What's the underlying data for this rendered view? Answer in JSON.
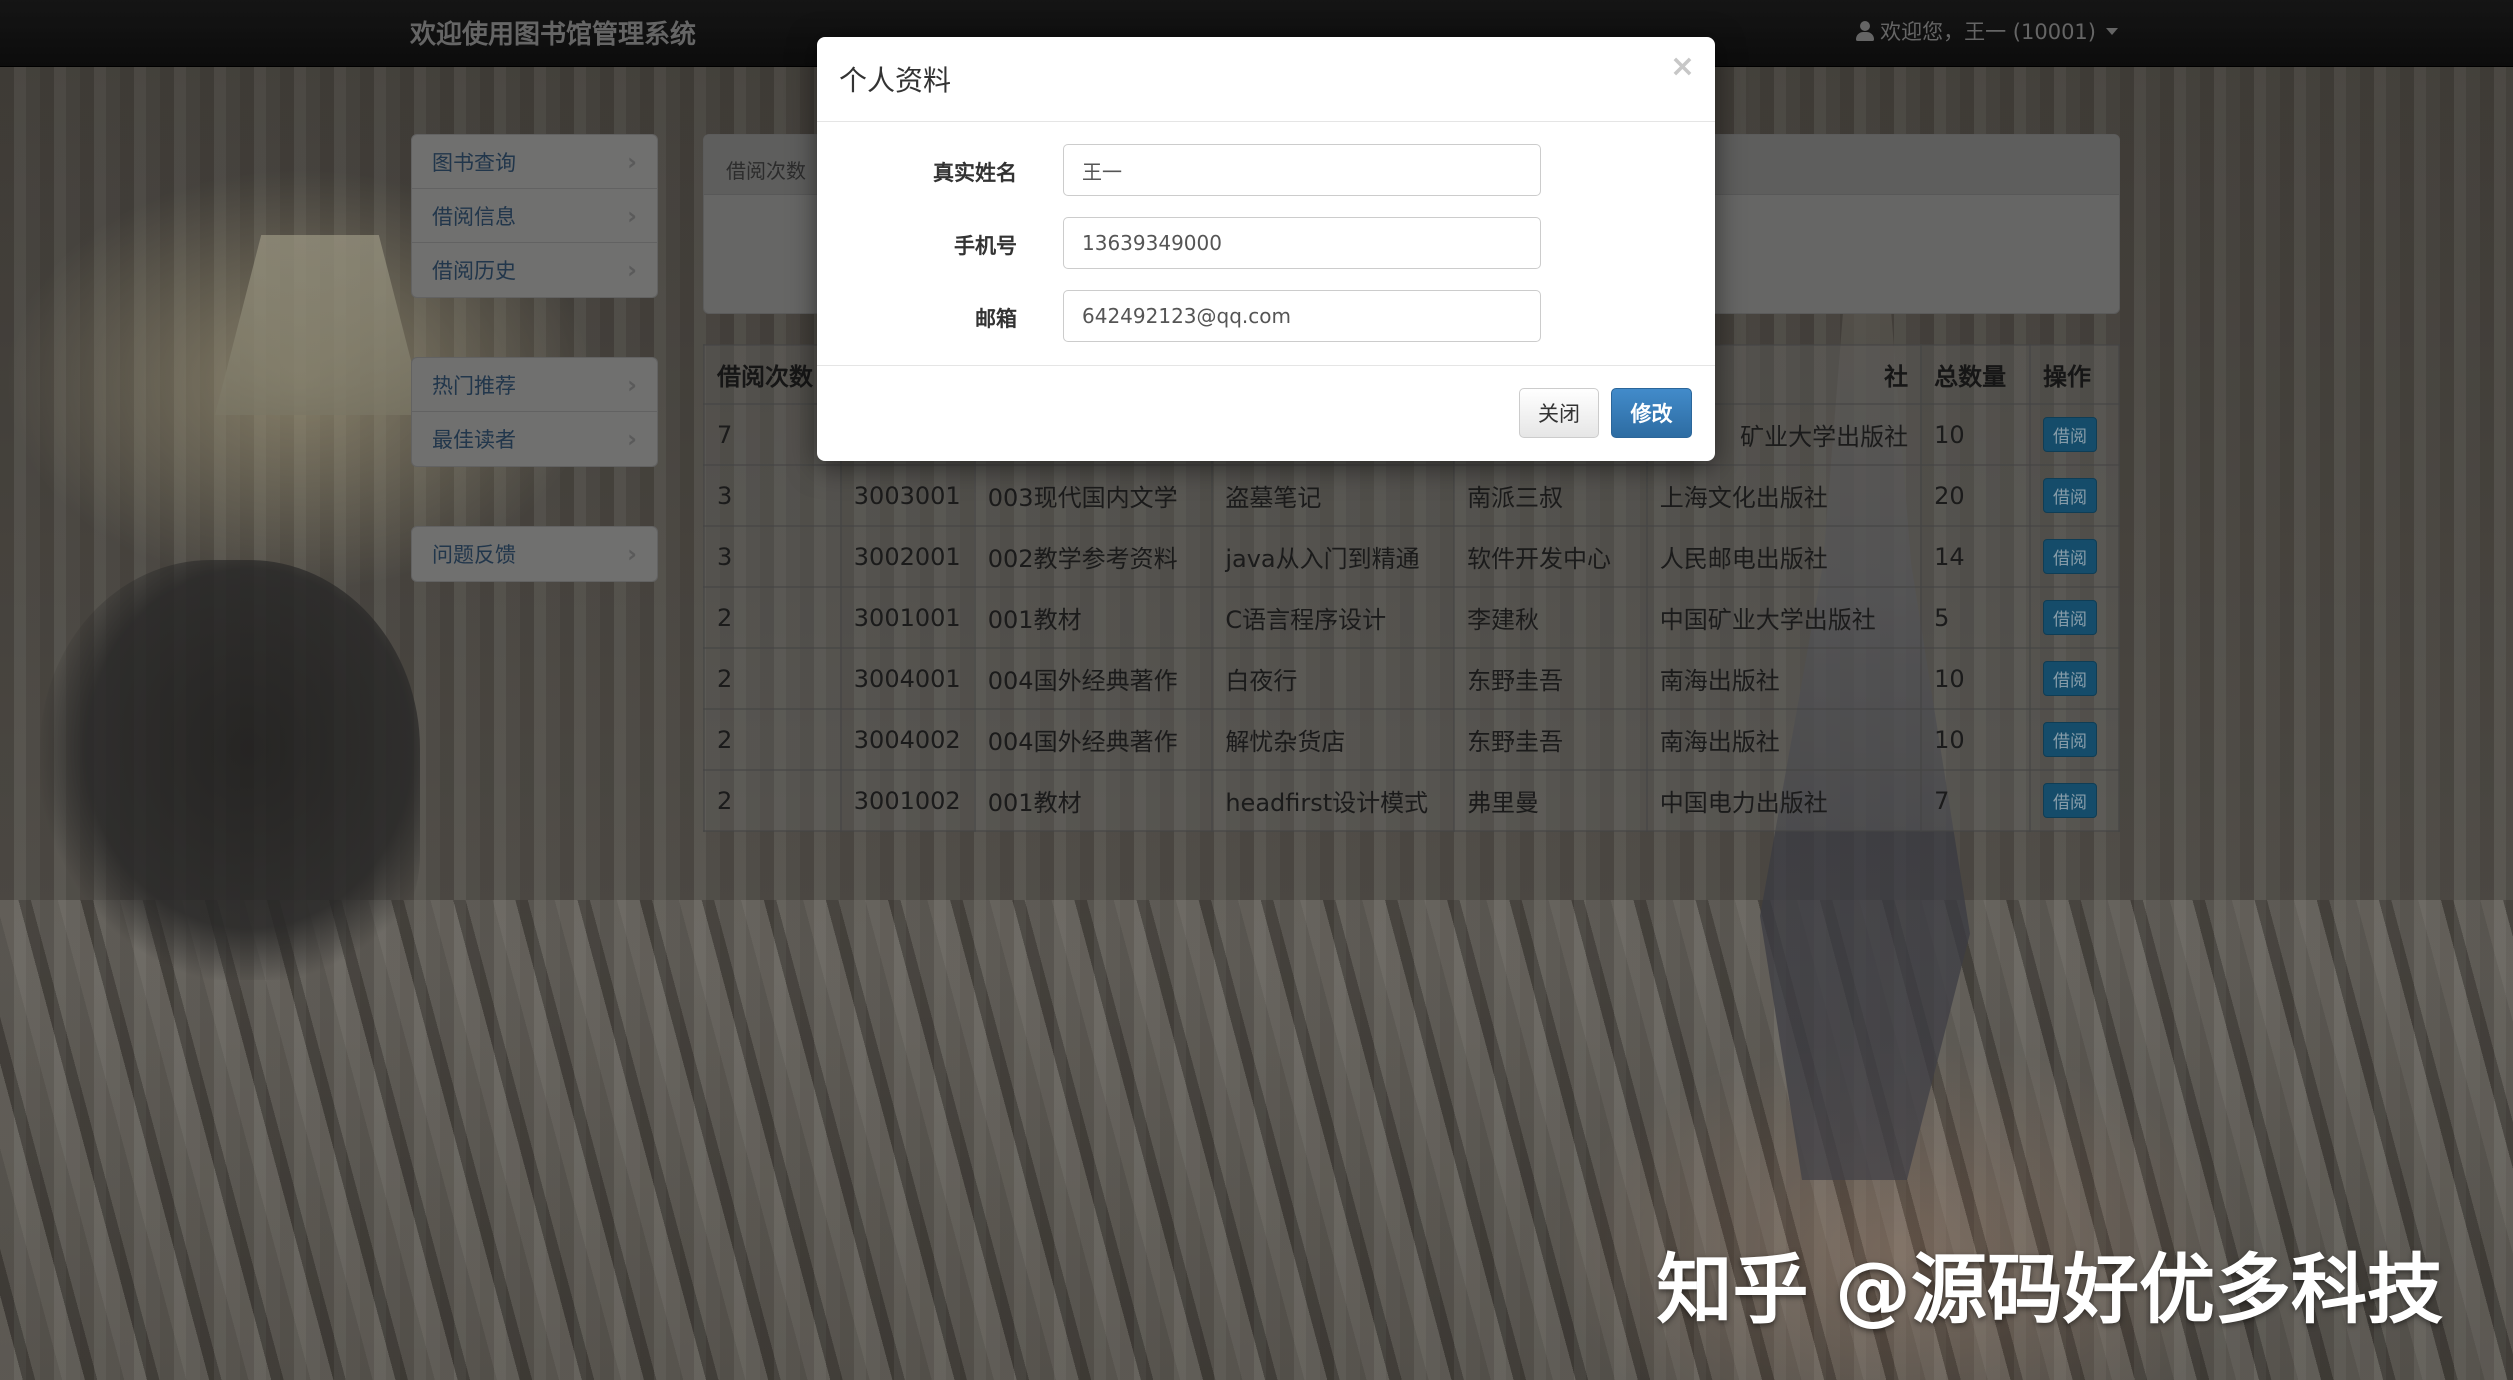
{
  "navbar": {
    "brand": "欢迎使用图书馆管理系统",
    "user_label": "欢迎您，王一 (10001)"
  },
  "sidebar": {
    "group1": [
      {
        "label": "图书查询"
      },
      {
        "label": "借阅信息"
      },
      {
        "label": "借阅历史"
      }
    ],
    "group2": [
      {
        "label": "热门推荐"
      },
      {
        "label": "最佳读者"
      }
    ],
    "group3": [
      {
        "label": "问题反馈"
      }
    ]
  },
  "panel": {
    "heading": "借阅次数"
  },
  "table": {
    "headers": [
      "借阅次数",
      "",
      "",
      "",
      "",
      "社",
      "总数量",
      "操作"
    ],
    "rows": [
      {
        "count": "7",
        "id": "",
        "category": "",
        "title": "",
        "author": "",
        "publisher": "矿业大学出版社",
        "total": "10",
        "action": "借阅"
      },
      {
        "count": "3",
        "id": "3003001",
        "category": "003现代国内文学",
        "title": "盗墓笔记",
        "author": "南派三叔",
        "publisher": "上海文化出版社",
        "total": "20",
        "action": "借阅"
      },
      {
        "count": "3",
        "id": "3002001",
        "category": "002教学参考资料",
        "title": "java从入门到精通",
        "author": "软件开发中心",
        "publisher": "人民邮电出版社",
        "total": "14",
        "action": "借阅"
      },
      {
        "count": "2",
        "id": "3001001",
        "category": "001教材",
        "title": "C语言程序设计",
        "author": "李建秋",
        "publisher": "中国矿业大学出版社",
        "total": "5",
        "action": "借阅"
      },
      {
        "count": "2",
        "id": "3004001",
        "category": "004国外经典著作",
        "title": "白夜行",
        "author": "东野圭吾",
        "publisher": "南海出版社",
        "total": "10",
        "action": "借阅"
      },
      {
        "count": "2",
        "id": "3004002",
        "category": "004国外经典著作",
        "title": "解忧杂货店",
        "author": "东野圭吾",
        "publisher": "南海出版社",
        "total": "10",
        "action": "借阅"
      },
      {
        "count": "2",
        "id": "3001002",
        "category": "001教材",
        "title": "headfirst设计模式",
        "author": "弗里曼",
        "publisher": "中国电力出版社",
        "total": "7",
        "action": "借阅"
      }
    ]
  },
  "modal": {
    "title": "个人资料",
    "close_glyph": "×",
    "fields": {
      "real_name": {
        "label": "真实姓名",
        "value": "王一"
      },
      "phone": {
        "label": "手机号",
        "value": "13639349000"
      },
      "email": {
        "label": "邮箱",
        "value": "642492123@qq.com"
      }
    },
    "close_button": "关闭",
    "modify_button": "修改"
  },
  "watermark": "知乎 @源码好优多科技",
  "colors": {
    "navbar_bg": "#111111",
    "primary_button": "#337ab7",
    "borrow_button": "#1e6a93",
    "sidebar_link": "#2f4b68"
  }
}
